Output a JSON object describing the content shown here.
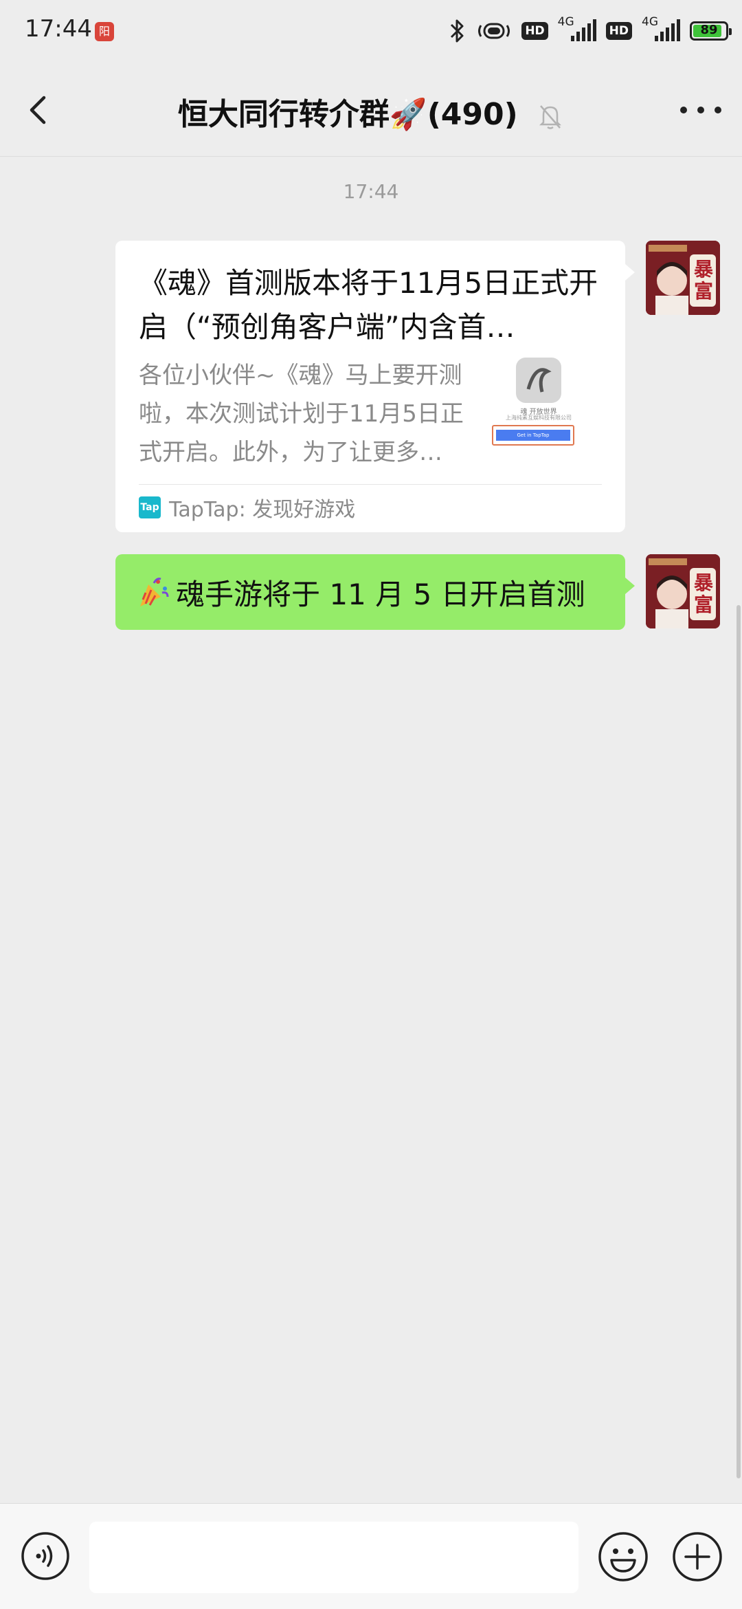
{
  "status_bar": {
    "time": "17:44",
    "network_1": "4G",
    "network_2": "4G",
    "hd_1": "HD",
    "hd_2": "HD",
    "battery_level": "89",
    "icons": [
      "notification-app-icon",
      "bluetooth-icon",
      "vibrate-icon",
      "hd-icon",
      "signal-icon",
      "battery-icon"
    ]
  },
  "header": {
    "title": "恒大同行转介群🚀(490)",
    "icons": [
      "back-icon",
      "mute-bell-icon",
      "more-icon"
    ]
  },
  "chat": {
    "timestamp": "17:44",
    "messages": [
      {
        "type": "link-card",
        "title": "《魂》首测版本将于11月5日正式开启（“预创角客户端”内含首…",
        "description": "各位小伙伴~《魂》马上要开测啦，本次测试计划于11月5日正式开启。此外，为了让更多…",
        "thumbnail_caption": "魂 开放世界",
        "thumbnail_company": "上海纯素互娱科技有限公司",
        "thumbnail_button": "Get in TapTap",
        "source": "TapTap: 发现好游戏",
        "source_logo": "Tap"
      },
      {
        "type": "text",
        "text": "魂手游将于 11 月 5 日开启首测",
        "emoji": "party-popper-icon"
      }
    ],
    "avatar_text": "暴富"
  },
  "input_bar": {
    "value": "",
    "icons": [
      "voice-icon",
      "emoji-icon",
      "plus-icon"
    ]
  },
  "colors": {
    "background": "#ededed",
    "sent_bubble": "#95ec69",
    "card": "#ffffff",
    "battery": "#3fc33a"
  }
}
